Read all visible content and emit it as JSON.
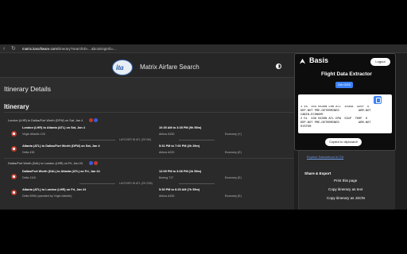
{
  "browser": {
    "url_host": "matrix.itasoftware.com",
    "url_path": "/itinerary?searchID=...&bookingInfo=..."
  },
  "site": {
    "title": "Matrix Airfare Search",
    "logo_text": "ita"
  },
  "page": {
    "heading": "Itinerary Details",
    "section_title": "Itinerary"
  },
  "slices": [
    {
      "label": "London (LHR) to Dallas/Fort Worth (DFW) on Sat, Jan 4",
      "segments": [
        {
          "route": "London (LHR) to Atlanta (ATL) on Sat, Jan 4",
          "carrier": "Virgin Atlantic 103",
          "time": "10:35 AM to 3:35 PM (9h 55m)",
          "aircraft": "Airbus A330",
          "cabin": "Economy (Y)"
        },
        {
          "route": "Atlanta (ATL) to Dallas/Fort Worth (DFW) on Sat, Jan 4",
          "carrier": "Delta 436",
          "time": "5:31 PM to 7:00 PM (2h 29m)",
          "aircraft": "Airbus A220",
          "cabin": "Economy (E)"
        }
      ],
      "layover": "LAYOVER IN ATL (2H 0M)"
    },
    {
      "label": "Dallas/Fort Worth (DAL) to London (LHR) on Fri, Jan 24",
      "segments": [
        {
          "route": "Dallas/Fort Worth (DAL) to Atlanta (ATL) on Fri, Jan 24",
          "carrier": "Delta 1115",
          "time": "12:09 PM to 3:08 PM (1h 59m)",
          "aircraft": "Boeing 717",
          "cabin": "Economy (E)"
        },
        {
          "route": "Atlanta (ATL) to London (LHR) on Fri, Jan 24",
          "carrier": "Delta 5998 (operated by Virgin Atlantic)",
          "time": "5:30 PM to 6:25 AM (7h 55m)",
          "aircraft": "Airbus A330",
          "cabin": "Economy (E)"
        }
      ],
      "layover": "LAYOVER IN ATL (2H 22M)"
    }
  ],
  "share": {
    "title": "Share & Export",
    "print": "Print this page",
    "copy_text": "Copy itinerary as text",
    "copy_json": "Copy itinerary as JSON",
    "link": "Explore Sakumbum in ITA"
  },
  "extension": {
    "name": "Basis",
    "logout": "Logout",
    "title": "Flight Data Extractor",
    "get_gds": "Get GDS",
    "gds_output": "1 VS  103 0430N LHR ATL  1035A  325P  O\nDEP-NOT PRE-DETERMINED           ARR-NOT\nCABIN-ECONOMY\n2 DL  436 0430N ATL DFW  531P  700P  O\nDEP-NOT PRE-DETERMINED           ARR-NOT\nSYSTEM",
    "copy_clipboard": "Copied to clipboard!"
  },
  "colors": {
    "accent": "#3b82f6",
    "background": "#1f1f1f",
    "airline_red": "#c0392b"
  }
}
